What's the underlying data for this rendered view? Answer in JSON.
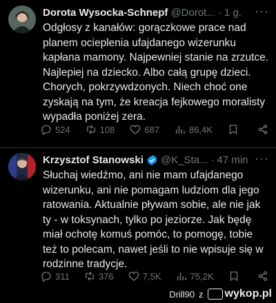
{
  "tweet1": {
    "name": "Dorota Wysocka-Schnepf",
    "handle": "@Dorot...",
    "sep": "·",
    "time": "1 g.",
    "more": "···",
    "text": "Odgłosy z kanałów: gorączkowe prace nad planem ocieplenia ufajdanego wizerunku kapłana mamony. Najpewniej stanie na zrzutce. Najlepiej na dziecko. Albo całą grupę dzieci. Chorych, pokrzywdzonych. Niech choć one zyskają na tym, że kreacja fejkowego moralisty wypadła poniżej zera.",
    "replies": "524",
    "reposts": "108",
    "likes": "687",
    "views": "86,4K"
  },
  "tweet2": {
    "name": "Krzysztof Stanowski",
    "handle": "@K_Sta...",
    "sep": "·",
    "time": "47 min",
    "more": "···",
    "text": "Słuchaj wiedźmo, ani nie mam ufajdanego wizerunku, ani nie pomagam ludziom dla jego ratowania. Aktualnie pływam sobie, ale nie jak ty - w toksynach, tylko po jeziorze. Jak będę miał ochotę komuś pomóc, to pomogę, tobie też to polecam, nawet jeśli to nie wpisuje się w rodzinne tradycje.",
    "replies": "311",
    "reposts": "376",
    "likes": "7,5K",
    "views": "75,2K"
  },
  "watermark": {
    "user": "Drill90",
    "z": "z",
    "site": "wykop.pl"
  },
  "colors": {
    "background": "#000000",
    "text": "#e7e9ea",
    "muted": "#71767b",
    "verified": "#1d9bf0",
    "divider": "#2f3336"
  }
}
